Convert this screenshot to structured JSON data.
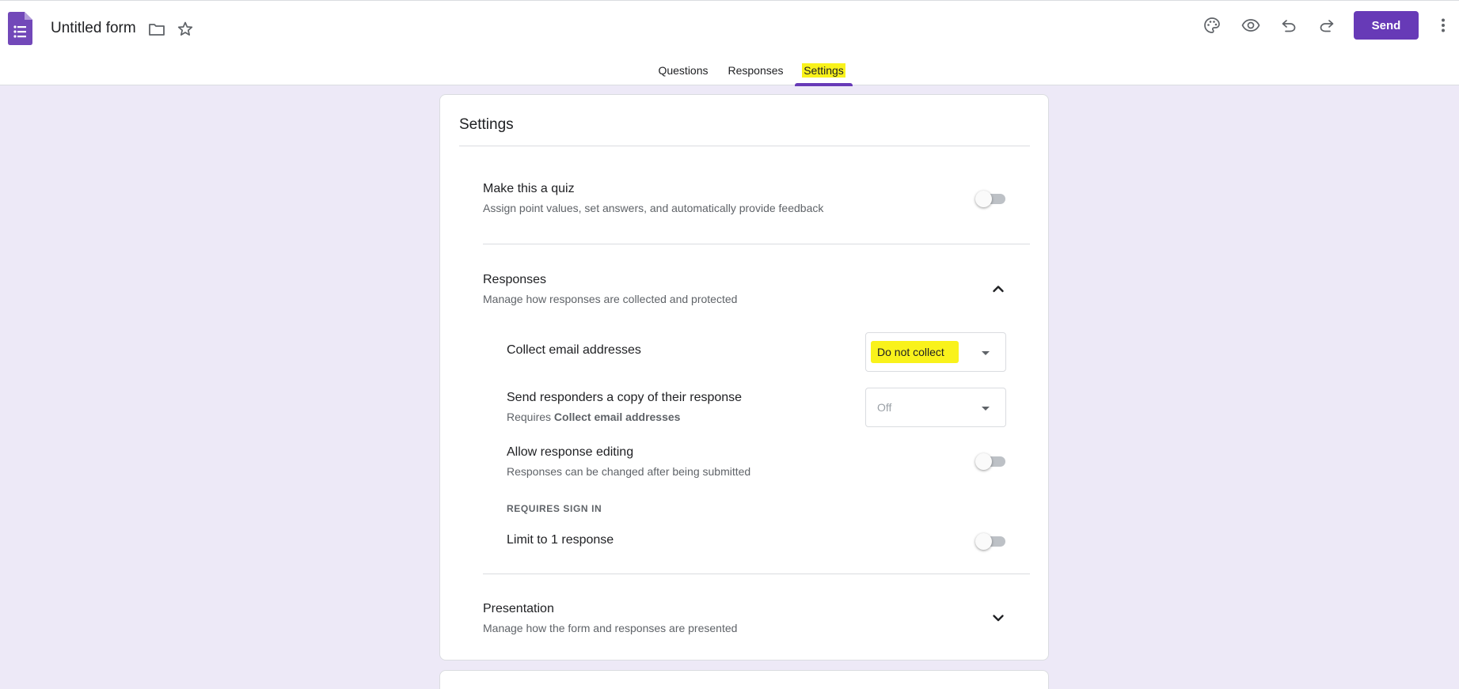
{
  "app": {
    "title": "Untitled form",
    "accent_color": "#673ab7",
    "background_color": "#ede9f7",
    "highlight_color": "#f9f21b"
  },
  "header": {
    "icons": [
      "forms-logo-icon",
      "folder-icon",
      "star-icon",
      "palette-icon",
      "preview-eye-icon",
      "undo-icon",
      "redo-icon",
      "more-vert-icon"
    ],
    "send_label": "Send"
  },
  "tabs": [
    {
      "label": "Questions",
      "active": false
    },
    {
      "label": "Responses",
      "active": false
    },
    {
      "label": "Settings",
      "active": true
    }
  ],
  "settings": {
    "title": "Settings",
    "quiz": {
      "title": "Make this a quiz",
      "subtitle": "Assign point values, set answers, and automatically provide feedback",
      "enabled": false
    },
    "responses": {
      "title": "Responses",
      "subtitle": "Manage how responses are collected and protected",
      "expanded": true,
      "collect_email": {
        "label": "Collect email addresses",
        "value": "Do not collect"
      },
      "send_copy": {
        "label": "Send responders a copy of their response",
        "requires_prefix": "Requires ",
        "requires_bold": "Collect email addresses",
        "value": "Off"
      },
      "allow_editing": {
        "label": "Allow response editing",
        "subtitle": "Responses can be changed after being submitted",
        "enabled": false
      },
      "requires_sign_in_heading": "REQUIRES SIGN IN",
      "limit_one": {
        "label": "Limit to 1 response",
        "enabled": false
      }
    },
    "presentation": {
      "title": "Presentation",
      "subtitle": "Manage how the form and responses are presented",
      "expanded": false
    }
  }
}
